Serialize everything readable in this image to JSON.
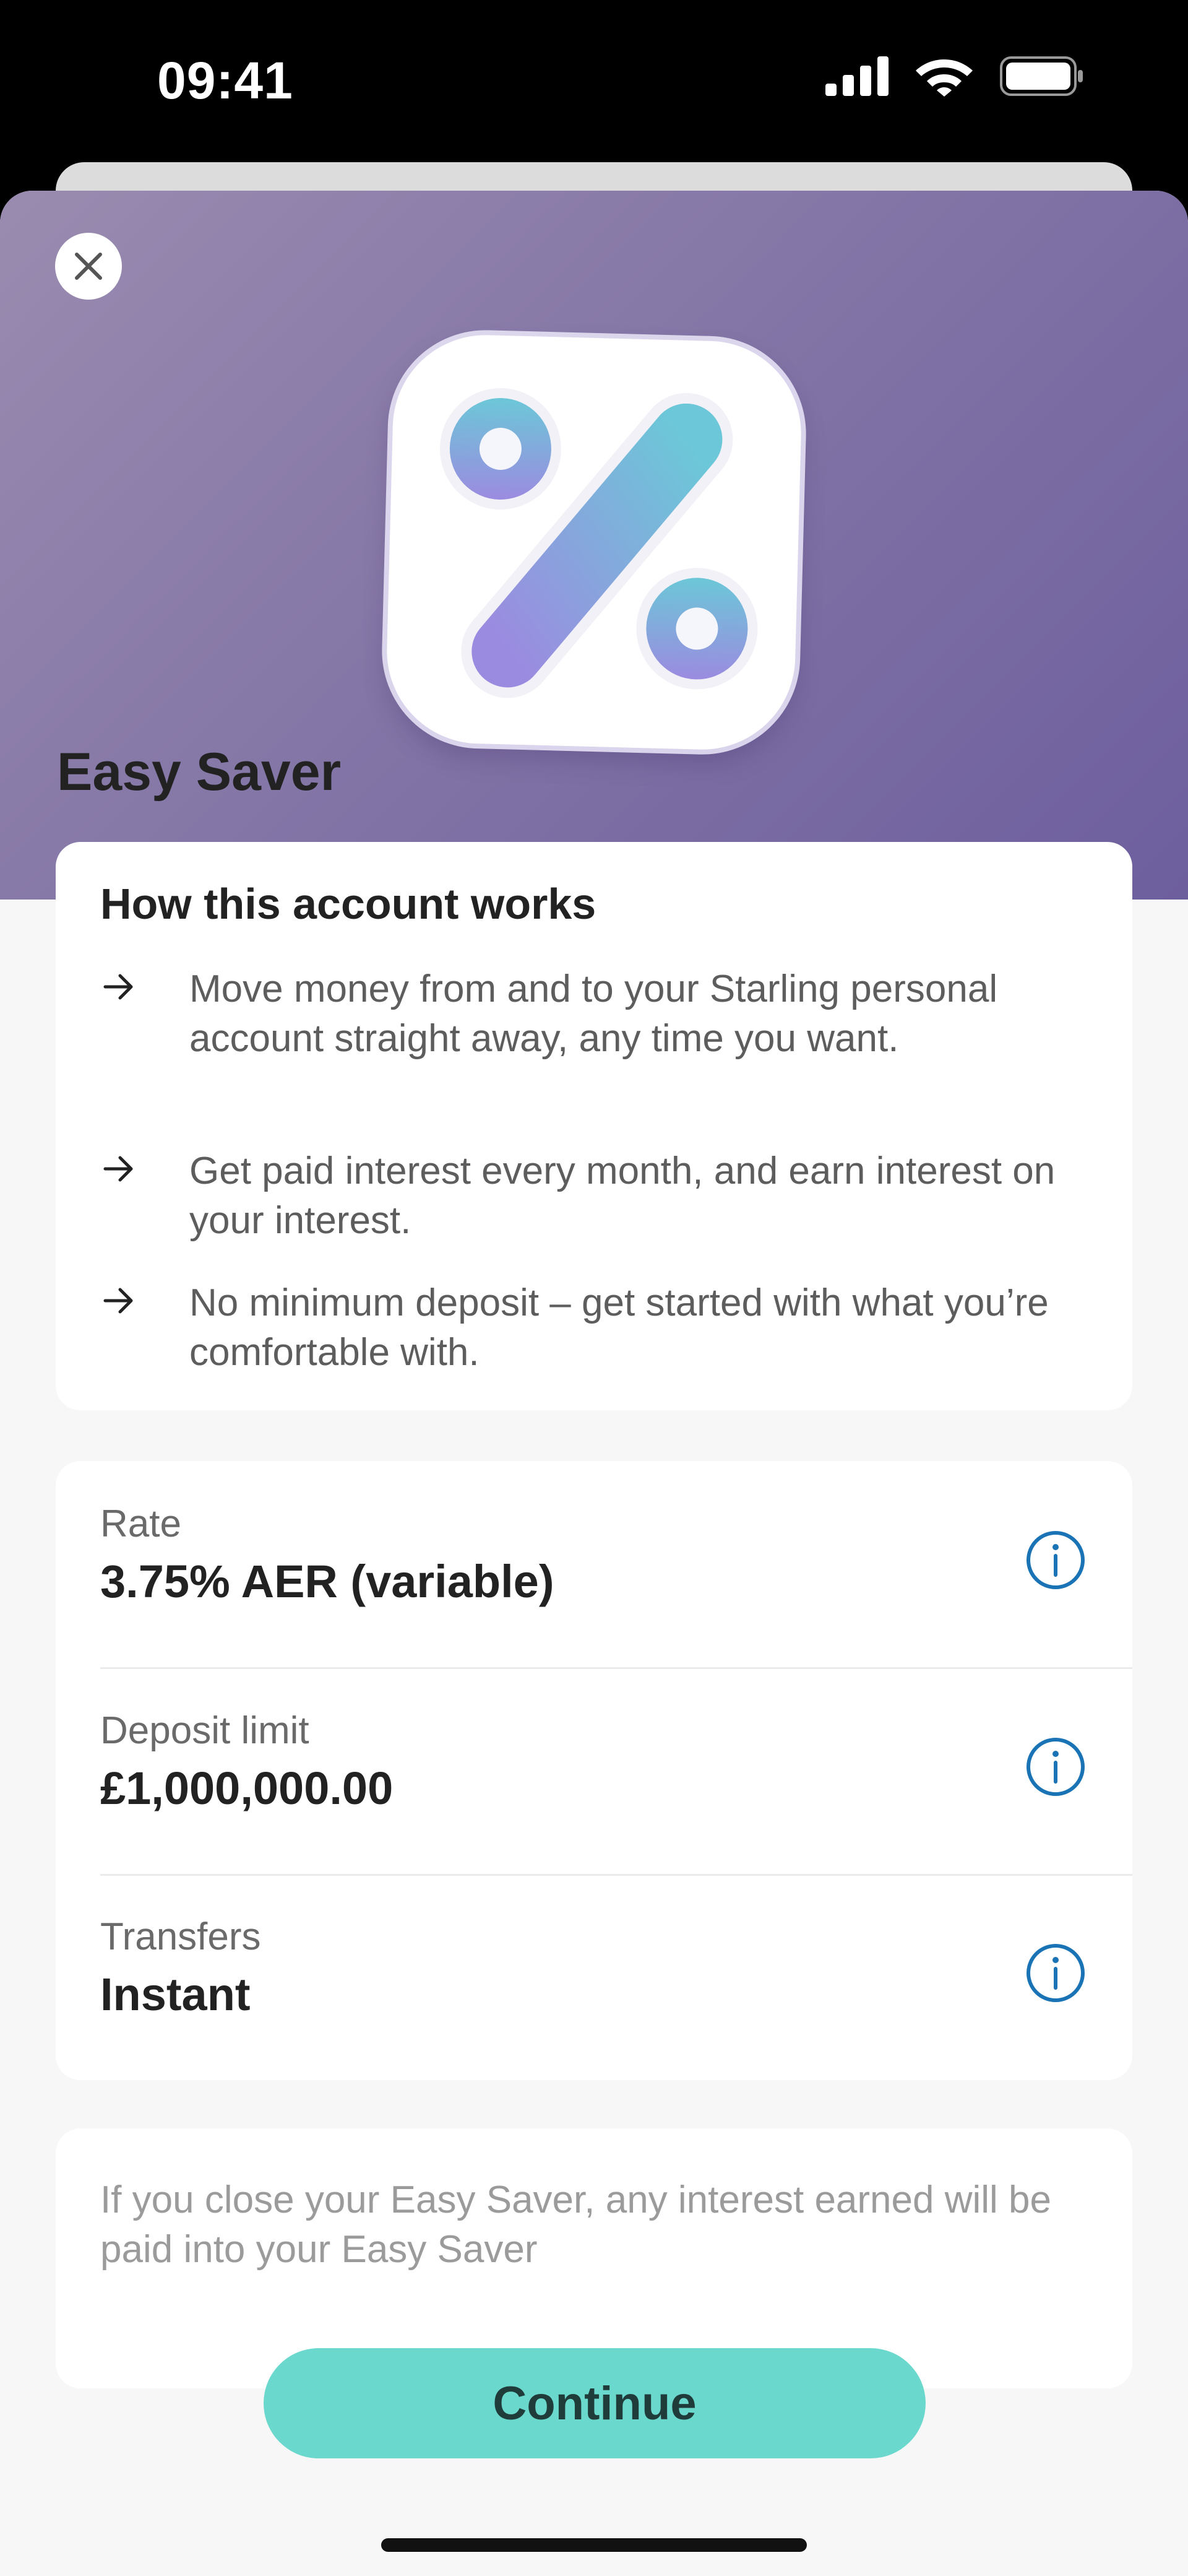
{
  "status_bar": {
    "time": "09:41",
    "icons": [
      "signal-icon",
      "wifi-icon",
      "battery-icon"
    ]
  },
  "header": {
    "close_icon": "close-icon",
    "hero_icon": "percent-icon"
  },
  "title": "Easy Saver",
  "how_it_works": {
    "heading": "How this account works",
    "bullets": [
      "Move money from and to your Starling personal account straight away, any time you want.",
      "Get paid interest every month, and earn interest on your interest.",
      "No minimum deposit – get started with what you’re comfortable with."
    ]
  },
  "details": [
    {
      "label": "Rate",
      "value": "3.75% AER (variable)"
    },
    {
      "label": "Deposit limit",
      "value": "£1,000,000.00"
    },
    {
      "label": "Transfers",
      "value": "Instant"
    }
  ],
  "note": {
    "text": "If you close your Easy Saver, any interest earned will be paid into your Easy Saver"
  },
  "continue_label": "Continue",
  "colors": {
    "hero_start": "#9a8bb0",
    "hero_end": "#6d5e9e",
    "button": "#6ad8cc",
    "info_icon": "#1a73b5"
  }
}
